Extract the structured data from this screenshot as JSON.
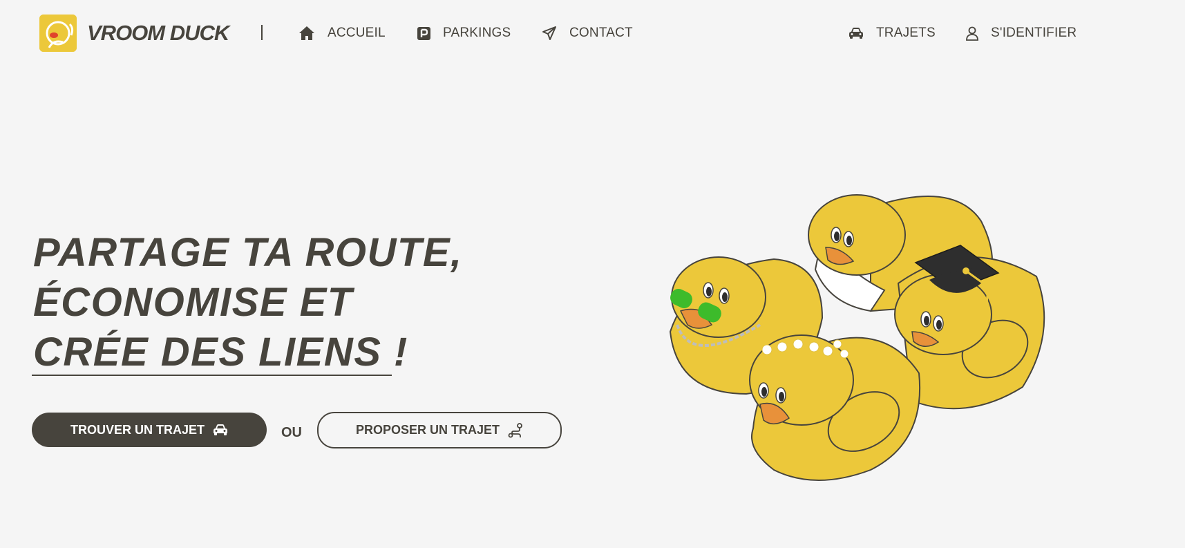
{
  "header": {
    "brand": "VROOM DUCK",
    "nav_left": [
      {
        "label": "ACCUEIL",
        "icon": "home-icon"
      },
      {
        "label": "PARKINGS",
        "icon": "parking-icon"
      },
      {
        "label": "CONTACT",
        "icon": "send-icon"
      }
    ],
    "nav_right": [
      {
        "label": "TRAJETS",
        "icon": "car-icon"
      },
      {
        "label": "S'IDENTIFIER",
        "icon": "user-icon"
      }
    ]
  },
  "hero": {
    "lines": [
      "PARTAGE TA ROUTE,",
      "ÉCONOMISE ET",
      "CRÉE DES LIENS !"
    ],
    "primary_button": "TROUVER UN TRAJET",
    "or_label": "OU",
    "secondary_button": "PROPOSER UN TRAJET"
  },
  "colors": {
    "background": "#f5f5f5",
    "text": "#47443d",
    "accent_yellow": "#ecc83a",
    "duck_beak": "#e8913a",
    "sunglasses": "#3dbb2b"
  }
}
